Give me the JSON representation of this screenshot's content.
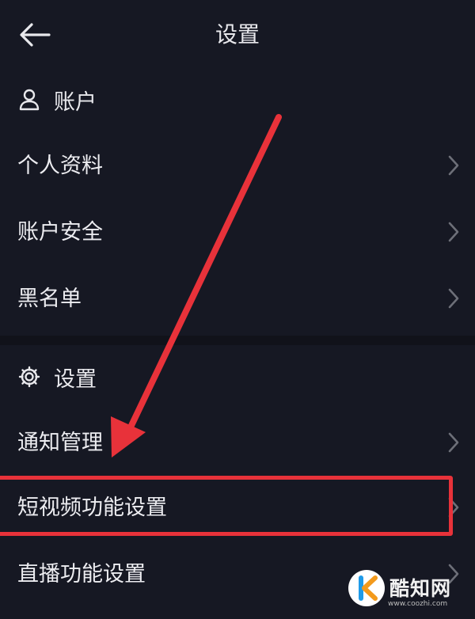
{
  "header": {
    "title": "设置"
  },
  "sections": {
    "account": {
      "title": "账户"
    },
    "settings": {
      "title": "设置"
    }
  },
  "account_rows": [
    {
      "label": "个人资料"
    },
    {
      "label": "账户安全"
    },
    {
      "label": "黑名单"
    }
  ],
  "settings_rows": [
    {
      "label": "通知管理"
    },
    {
      "label": "短视频功能设置",
      "highlighted": true
    },
    {
      "label": "直播功能设置"
    }
  ],
  "annotation": {
    "highlight_color": "#e8323a"
  },
  "watermark": {
    "name": "酷知网",
    "url": "www.coozhi.com"
  },
  "colors": {
    "background": "#161823",
    "divider": "#11121a",
    "accent": "#e8323a"
  }
}
